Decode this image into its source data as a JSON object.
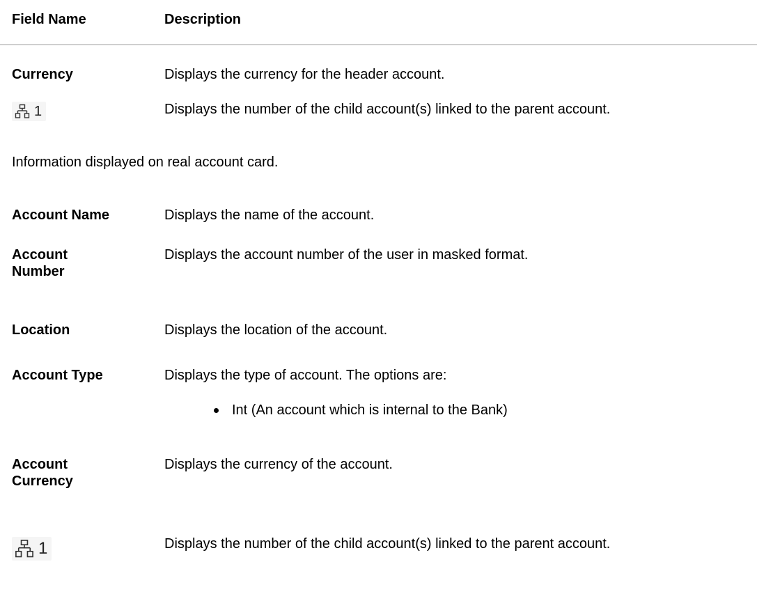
{
  "header": {
    "field_name": "Field Name",
    "description": "Description"
  },
  "rows_top": [
    {
      "label": "Currency",
      "description": "Displays the currency for the header account."
    },
    {
      "icon": "hierarchy-icon",
      "icon_count": "1",
      "description": "Displays the number of the child account(s) linked to the parent account."
    }
  ],
  "section_note": "Information displayed on real account card.",
  "rows_bottom": [
    {
      "label": "Account Name",
      "description": "Displays the name of the account."
    },
    {
      "label_line1": "Account",
      "label_line2": "Number",
      "description": "Displays the account number of the user in masked format."
    },
    {
      "label": "Location",
      "description": "Displays the location of the account."
    },
    {
      "label": "Account Type",
      "description": "Displays the type of account. The options are:",
      "options": [
        "Int (An account which is internal to the Bank)"
      ]
    },
    {
      "label_line1": "Account",
      "label_line2": "Currency",
      "description": "Displays the currency of the account."
    },
    {
      "icon": "hierarchy-icon",
      "icon_count": "1",
      "description": "Displays the number of the child account(s) linked to the parent account."
    }
  ]
}
